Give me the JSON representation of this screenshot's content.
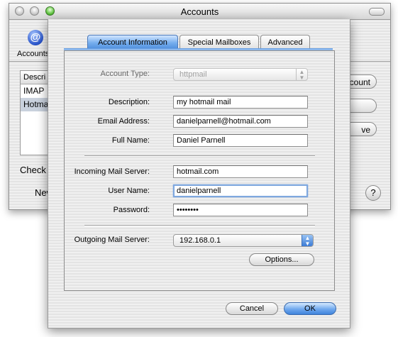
{
  "back_window": {
    "title": "Accounts",
    "toolbar": {
      "icon": "at-sign-icon",
      "label": "Accounts"
    },
    "list": {
      "header": "Descri",
      "items": [
        {
          "label": "IMAP",
          "selected": false
        },
        {
          "label": "Hotma",
          "selected": true
        }
      ]
    },
    "check_label": "Check fo",
    "new_label": "New",
    "buttons": {
      "b1": "count",
      "b2": "",
      "b3": "ve"
    },
    "help_label": "?"
  },
  "sheet": {
    "tabs": [
      {
        "label": "Account Information",
        "selected": true
      },
      {
        "label": "Special Mailboxes",
        "selected": false
      },
      {
        "label": "Advanced",
        "selected": false
      }
    ],
    "account_type": {
      "label": "Account Type:",
      "value": "httpmail",
      "enabled": false
    },
    "description": {
      "label": "Description:",
      "value": "my hotmail mail"
    },
    "email_address": {
      "label": "Email Address:",
      "value": "danielparnell@hotmail.com"
    },
    "full_name": {
      "label": "Full Name:",
      "value": "Daniel Parnell"
    },
    "incoming_server": {
      "label": "Incoming Mail Server:",
      "value": "hotmail.com"
    },
    "user_name": {
      "label": "User Name:",
      "value": "danielparnell",
      "focused": true
    },
    "password": {
      "label": "Password:",
      "value": "••••••••"
    },
    "outgoing_server": {
      "label": "Outgoing Mail Server:",
      "value": "192.168.0.1"
    },
    "options_button": "Options...",
    "cancel_button": "Cancel",
    "ok_button": "OK"
  },
  "colors": {
    "accent": "#4f8fdd",
    "focus_ring": "#7fa8df"
  }
}
